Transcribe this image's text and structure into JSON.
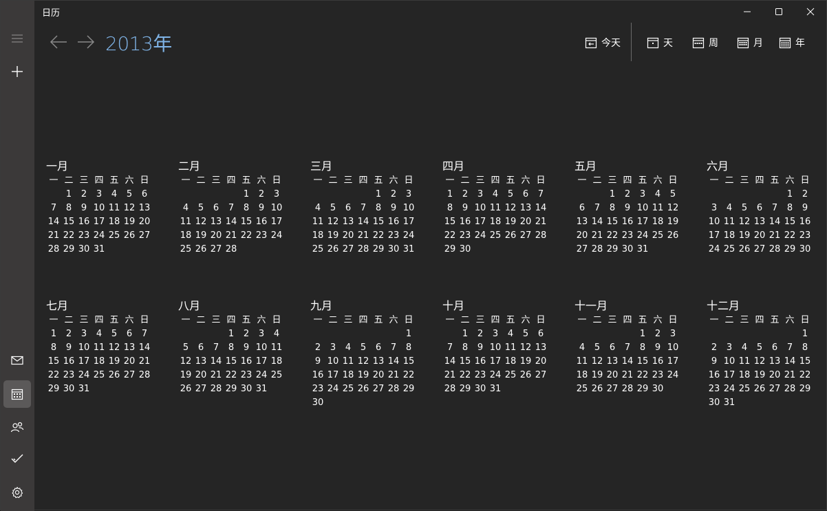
{
  "window": {
    "title": "日历"
  },
  "header": {
    "year_title": "2013年",
    "today_label": "今天",
    "views": [
      {
        "label": "天",
        "icon": "day-view-icon"
      },
      {
        "label": "周",
        "icon": "week-view-icon"
      },
      {
        "label": "月",
        "icon": "month-view-icon"
      },
      {
        "label": "年",
        "icon": "year-view-icon"
      }
    ]
  },
  "sidebar": {
    "items": [
      {
        "name": "menu",
        "icon": "hamburger-icon"
      },
      {
        "name": "new-event",
        "icon": "plus-icon"
      },
      {
        "name": "mail",
        "icon": "mail-icon"
      },
      {
        "name": "calendar",
        "icon": "calendar-icon",
        "active": true
      },
      {
        "name": "people",
        "icon": "people-icon"
      },
      {
        "name": "todo",
        "icon": "checkmark-icon"
      },
      {
        "name": "settings",
        "icon": "gear-icon"
      }
    ]
  },
  "weekdays": [
    "一",
    "二",
    "三",
    "四",
    "五",
    "六",
    "日"
  ],
  "months": [
    {
      "name": "一月",
      "offset": 1,
      "days": 31
    },
    {
      "name": "二月",
      "offset": 4,
      "days": 28
    },
    {
      "name": "三月",
      "offset": 4,
      "days": 31
    },
    {
      "name": "四月",
      "offset": 0,
      "days": 30
    },
    {
      "name": "五月",
      "offset": 2,
      "days": 31
    },
    {
      "name": "六月",
      "offset": 5,
      "days": 30
    },
    {
      "name": "七月",
      "offset": 0,
      "days": 31
    },
    {
      "name": "八月",
      "offset": 3,
      "days": 31
    },
    {
      "name": "九月",
      "offset": 6,
      "days": 30
    },
    {
      "name": "十月",
      "offset": 1,
      "days": 31
    },
    {
      "name": "十一月",
      "offset": 4,
      "days": 30
    },
    {
      "name": "十二月",
      "offset": 6,
      "days": 31
    }
  ]
}
